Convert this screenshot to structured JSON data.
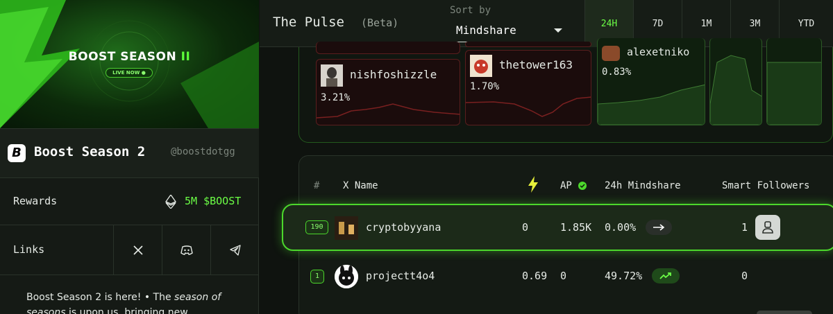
{
  "banner": {
    "title_main": "BOOST SEASON",
    "title_accent": "II",
    "live_label": "LIVE NOW ●"
  },
  "project": {
    "logo_letter": "B",
    "name": "Boost Season 2",
    "handle": "@boostdotgg"
  },
  "rewards": {
    "label": "Rewards",
    "value": "5M $BOOST",
    "icon": "ethereum-icon"
  },
  "links": {
    "label": "Links",
    "items": [
      {
        "icon": "x-twitter-icon"
      },
      {
        "icon": "discord-icon"
      },
      {
        "icon": "telegram-icon"
      }
    ]
  },
  "description": {
    "part1": "Boost Season 2 is here! • The ",
    "italic": "season of seasons",
    "part2": " is upon us, bringing new"
  },
  "pulse": {
    "title": "The Pulse",
    "badge": "(Beta)",
    "sort_label": "Sort by",
    "sort_value": "Mindshare"
  },
  "timeframes": [
    {
      "label": "24H",
      "active": true
    },
    {
      "label": "7D",
      "active": false
    },
    {
      "label": "1M",
      "active": false
    },
    {
      "label": "3M",
      "active": false
    },
    {
      "label": "YTD",
      "active": false
    }
  ],
  "treemap": [
    {
      "name": "nishfoshizzle",
      "pct": "3.21%",
      "trend": "down"
    },
    {
      "name": "thetower163",
      "pct": "1.70%",
      "trend": "down"
    },
    {
      "name": "alexetniko",
      "pct": "0.83%",
      "trend": "up"
    }
  ],
  "table": {
    "headers": {
      "rank": "#",
      "name": "X Name",
      "boost_icon": "lightning-icon",
      "ap": "AP",
      "mindshare": "24h Mindshare",
      "followers": "Smart Followers"
    },
    "rows": [
      {
        "rank": "190",
        "name": "cryptobyyana",
        "boost": "0",
        "ap": "1.85K",
        "mindshare": "0.00%",
        "trend": "flat",
        "followers": "1"
      },
      {
        "rank": "1",
        "name": "projectt4o4",
        "boost": "0.69",
        "ap": "0",
        "mindshare": "49.72%",
        "trend": "up",
        "followers": "0"
      }
    ]
  },
  "colors": {
    "accent": "#6cff46",
    "background": "#0f130f",
    "negative_tile": "#1b0c0c",
    "positive_tile": "#0f1f0e"
  }
}
